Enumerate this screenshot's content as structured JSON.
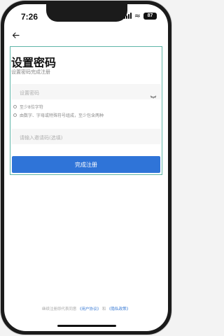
{
  "status_bar": {
    "time": "7:26",
    "battery": "87"
  },
  "page": {
    "title": "设置密码",
    "subtitle": "设置密码完成注册"
  },
  "form": {
    "password_placeholder": "设置密码",
    "rules": [
      "至少8位字符",
      "由数字、字母或特殊符号组成，至少包含两种"
    ],
    "invite_placeholder": "请输入邀请码(选填)",
    "submit_label": "完成注册"
  },
  "agreement": {
    "prefix": "继续注册即代表同意",
    "user_agreement": "《用户协议》",
    "and": "和",
    "privacy_policy": "《隐私政策》"
  },
  "colors": {
    "accent": "#2f74d8",
    "frame_highlight": "#5fb6a8"
  }
}
